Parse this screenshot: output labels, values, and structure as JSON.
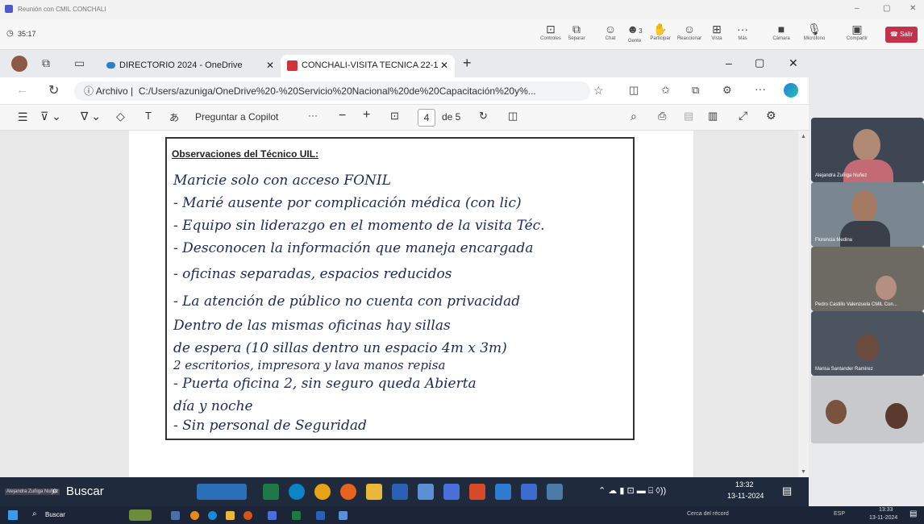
{
  "teams": {
    "window_title": "Reunión con CMIL CONCHALI",
    "timer": "35:17",
    "toolbar": [
      {
        "label": "Controles",
        "icon": "controls-icon"
      },
      {
        "label": "Separar",
        "icon": "pop-out-icon"
      },
      {
        "label": "Chat",
        "icon": "chat-icon"
      },
      {
        "label": "Gente",
        "icon": "people-icon",
        "badge": "3"
      },
      {
        "label": "Participar",
        "icon": "raise-hand-icon"
      },
      {
        "label": "Reaccionar",
        "icon": "react-icon"
      },
      {
        "label": "Vista",
        "icon": "view-icon"
      },
      {
        "label": "Más",
        "icon": "more-icon"
      },
      {
        "label": "Cámara",
        "icon": "camera-icon"
      },
      {
        "label": "Micrófono",
        "icon": "mic-icon"
      },
      {
        "label": "Compartir",
        "icon": "share-icon"
      }
    ],
    "leave_label": "Salir",
    "window_controls": [
      "–",
      "▢",
      "✕"
    ]
  },
  "browser": {
    "tabs": [
      {
        "title": "DIRECTORIO 2024 - OneDrive",
        "active": false
      },
      {
        "title": "CONCHALI-VISITA TECNICA 22-1",
        "active": true
      }
    ],
    "address_prefix": "Archivo",
    "address": "C:/Users/azuniga/OneDrive%20-%20Servicio%20Nacional%20de%20Capacitación%20y%..."
  },
  "pdf_toolbar": {
    "copilot_label": "Preguntar a Copilot",
    "more": "···",
    "zoom_out": "−",
    "zoom_in": "+",
    "page_current": "4",
    "page_total_label": "de 5"
  },
  "document": {
    "heading": "Observaciones del Técnico UIL:",
    "handwritten_lines": [
      "Maricie solo con acceso FONIL",
      "- Marié ausente por complicación médica (con lic)",
      "- Equipo sin liderazgo en el momento de la visita Téc.",
      "- Desconocen la información que maneja encargada",
      "- oficinas separadas, espacios reducidos",
      "- La atención de público no cuenta con privacidad",
      "Dentro de las mismas oficinas hay sillas",
      "de espera (10 sillas dentro un espacio 4m x 3m)",
      "2 escritorios, impresora y lava manos repisa",
      "- Puerta oficina 2, sin seguro queda Abierta",
      "día y noche",
      "- Sin personal de Seguridad"
    ]
  },
  "participants": [
    {
      "name": "Alejandra Zuñiga Nuñez",
      "bg": "#3e4654"
    },
    {
      "name": "Florencia Medina",
      "bg": "#7a8690"
    },
    {
      "name": "Pedro Castillo Valenzuela CMIL Con...",
      "bg": "#6d6a64"
    },
    {
      "name": "Marisa Santander Ramírez",
      "bg": "#4c5460"
    },
    {
      "name": "",
      "bg": "#c7c9cc"
    }
  ],
  "virtual_taskbar": {
    "search_label": "Buscar",
    "self_label": "Alejandra Zuñiga Nuñez",
    "time": "13:32",
    "date": "13-11-2024"
  },
  "host_taskbar": {
    "search_label": "Buscar",
    "weather": "Cerca del récord",
    "lang": "ESP",
    "time": "13:33",
    "date": "13-11-2024"
  }
}
